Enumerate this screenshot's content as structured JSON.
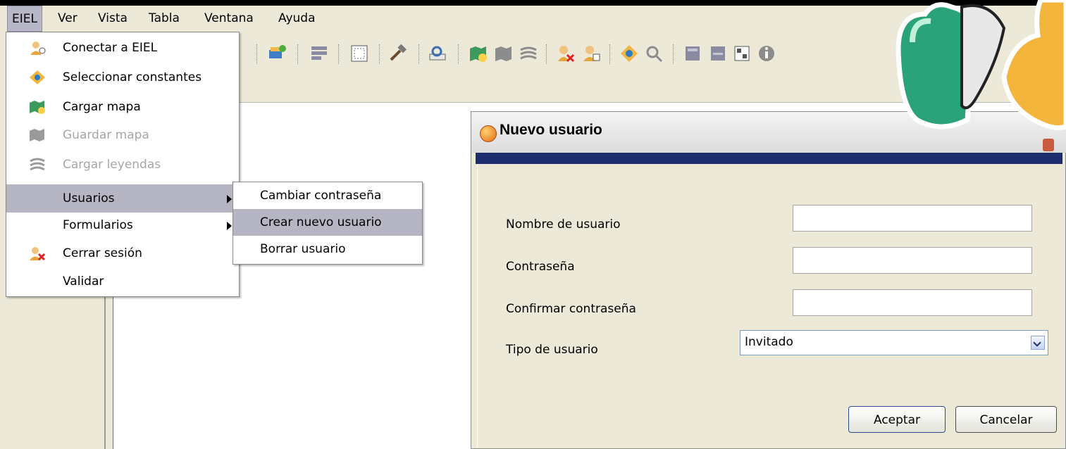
{
  "menubar": {
    "items": [
      "EIEL",
      "Ver",
      "Vista",
      "Tabla",
      "Ventana",
      "Ayuda"
    ]
  },
  "toolbar": {
    "icons": [
      "connect-icon",
      "layout-icon",
      "grid-icon",
      "tools-icon",
      "search-doc-icon",
      "load-map-icon",
      "save-map-icon",
      "legend-icon",
      "logout-icon",
      "user-icon",
      "target-icon",
      "zoom-icon",
      "export-icon",
      "table-icon",
      "window-icon",
      "info-icon"
    ]
  },
  "eiel_menu": {
    "items": [
      {
        "label": "Conectar a EIEL",
        "icon": "connect-icon",
        "enabled": true
      },
      {
        "label": "Seleccionar constantes",
        "icon": "target-icon",
        "enabled": true
      },
      {
        "label": "Cargar mapa",
        "icon": "load-map-icon",
        "enabled": true
      },
      {
        "label": "Guardar mapa",
        "icon": "save-map-icon",
        "enabled": false
      },
      {
        "label": "Cargar leyendas",
        "icon": "legend-icon",
        "enabled": false
      },
      {
        "label": "Usuarios",
        "submenu": true
      },
      {
        "label": "Formularios",
        "submenu": true
      },
      {
        "label": "Cerrar sesión",
        "icon": "logout-icon",
        "enabled": true
      },
      {
        "label": "Validar",
        "enabled": true
      }
    ]
  },
  "usuarios_submenu": {
    "items": [
      "Cambiar contraseña",
      "Crear nuevo usuario",
      "Borrar usuario"
    ]
  },
  "dialog": {
    "title": "Nuevo usuario",
    "fields": {
      "username_label": "Nombre de usuario",
      "username_value": "",
      "password_label": "Contraseña",
      "password_value": "",
      "confirm_label": "Confirmar contraseña",
      "confirm_value": "",
      "type_label": "Tipo de usuario",
      "type_value": "Invitado"
    },
    "accept_label": "Aceptar",
    "cancel_label": "Cancelar"
  },
  "colors": {
    "menu_highlight": "#b5b5c3",
    "dialog_band": "#1e2d6e",
    "window_bg": "#ece9d8"
  }
}
